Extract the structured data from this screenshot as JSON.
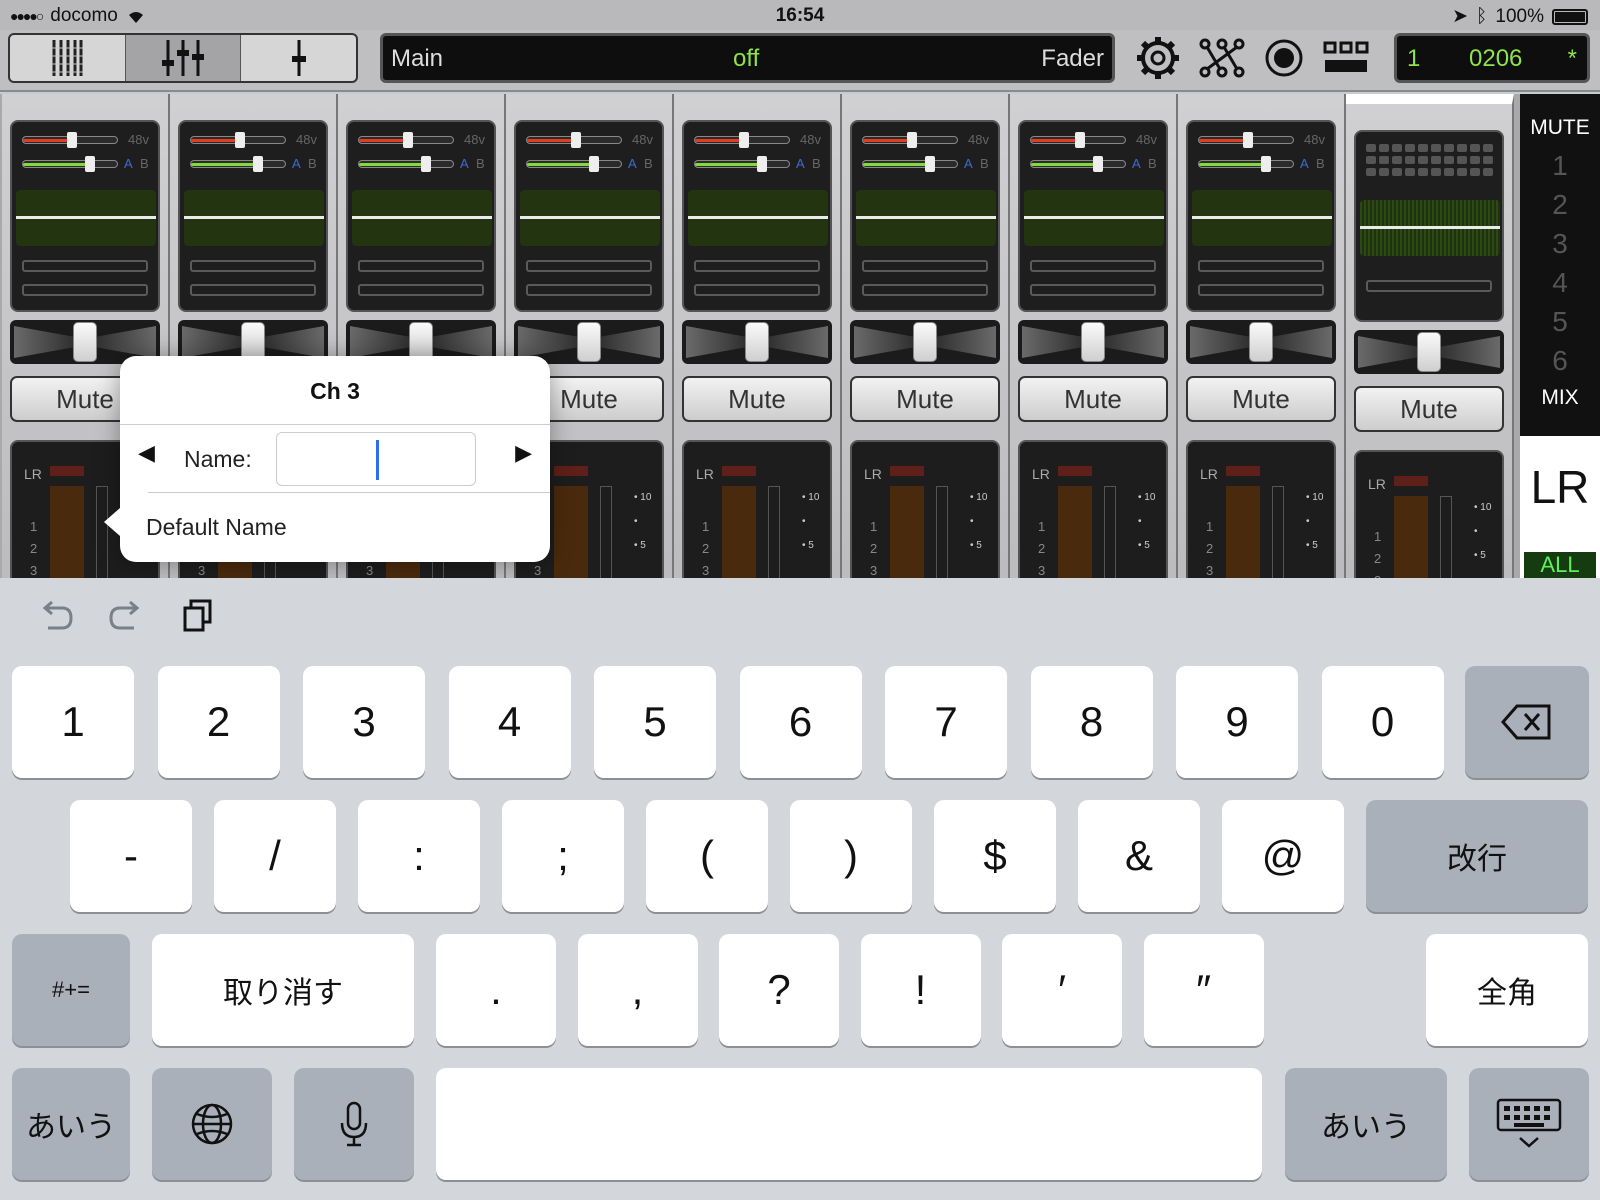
{
  "status": {
    "carrier": "docomo",
    "time": "16:54",
    "battery": "100%"
  },
  "toolbar": {
    "display_left": "Main",
    "display_center": "off",
    "display_right": "Fader",
    "counter_left": "1",
    "counter_center": "0206",
    "counter_right": "*"
  },
  "strips": {
    "mute_label": "Mute",
    "phantom": "48v",
    "a": "A",
    "b": "B",
    "lr": "LR",
    "meter_nums": [
      "1",
      "2",
      "3"
    ],
    "meter_scale": [
      "• 10",
      "•",
      "• 5"
    ]
  },
  "side": {
    "title": "MUTE",
    "groups": [
      "1",
      "2",
      "3",
      "4",
      "5",
      "6"
    ],
    "mix": "MIX",
    "lr": "LR",
    "all": "ALL"
  },
  "popup": {
    "title": "Ch 3",
    "name_label": "Name:",
    "name_value": "",
    "prev": "◀",
    "next": "▶",
    "default_name": "Default Name"
  },
  "keyboard": {
    "row1": [
      "1",
      "2",
      "3",
      "4",
      "5",
      "6",
      "7",
      "8",
      "9",
      "0"
    ],
    "row2": [
      "-",
      "/",
      ":",
      ";",
      "(",
      ")",
      "$",
      "&",
      "@"
    ],
    "return": "改行",
    "symbols": "#+=",
    "undo_key": "取り消す",
    "row3": [
      ".",
      ",",
      "?",
      "!",
      "′",
      "″"
    ],
    "fullwidth": "全角",
    "kana": "あいう"
  },
  "colors": {
    "accent_green": "#8fe34a",
    "blue_caret": "#2f6cf0"
  }
}
